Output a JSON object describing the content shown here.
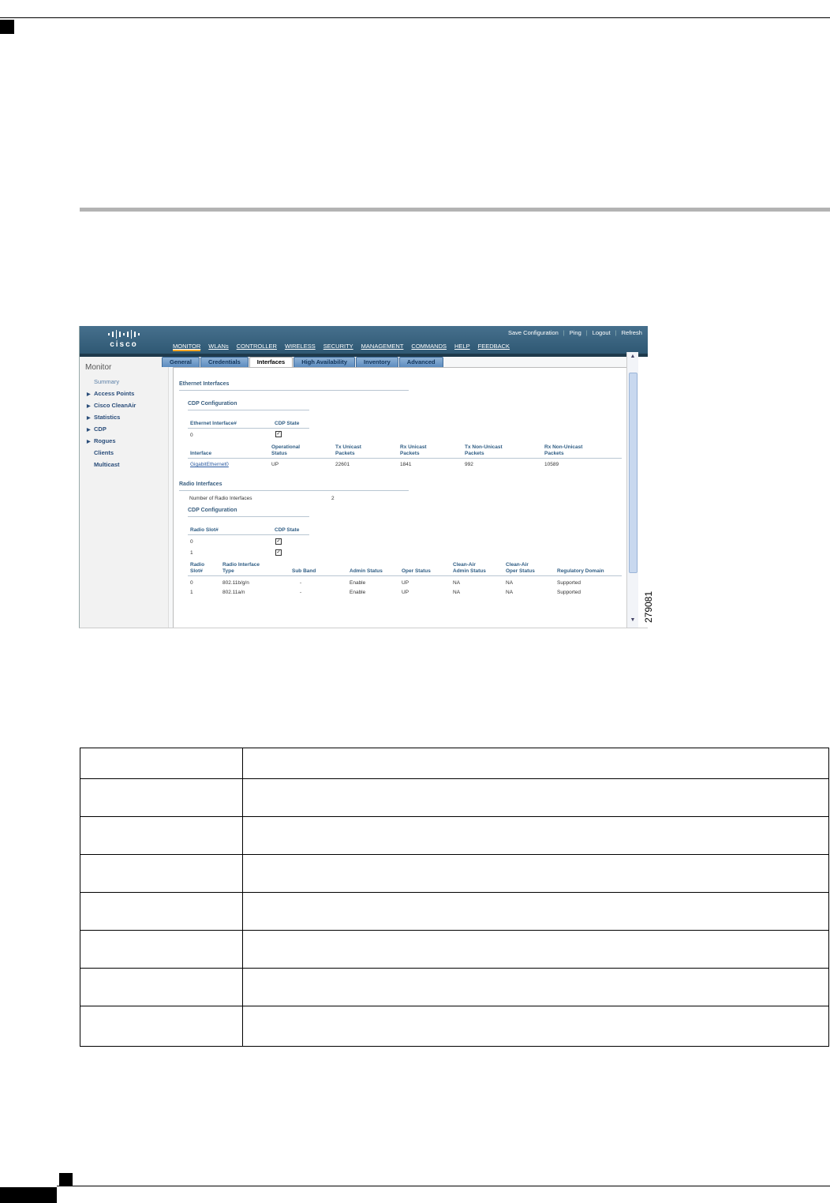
{
  "figure_id": "279081",
  "wlc": {
    "utility_links": [
      "Save Configuration",
      "Ping",
      "Logout",
      "Refresh"
    ],
    "nav": [
      "MONITOR",
      "WLANs",
      "CONTROLLER",
      "WIRELESS",
      "SECURITY",
      "MANAGEMENT",
      "COMMANDS",
      "HELP",
      "FEEDBACK"
    ],
    "logo_text": "cisco",
    "sidebar": {
      "title": "Monitor",
      "items": [
        {
          "label": "Summary",
          "arrow": false
        },
        {
          "label": "Access Points",
          "arrow": true
        },
        {
          "label": "Cisco CleanAir",
          "arrow": true
        },
        {
          "label": "Statistics",
          "arrow": true
        },
        {
          "label": "CDP",
          "arrow": true
        },
        {
          "label": "Rogues",
          "arrow": true
        },
        {
          "label": "Clients",
          "arrow": false
        },
        {
          "label": "Multicast",
          "arrow": false
        }
      ]
    },
    "tabs": [
      "General",
      "Credentials",
      "Interfaces",
      "High Availability",
      "Inventory",
      "Advanced"
    ],
    "active_tab": "Interfaces",
    "ethernet": {
      "section_title": "Ethernet Interfaces",
      "cdp_title": "CDP Configuration",
      "cdp_headers": [
        "Ethernet Interface#",
        "CDP State"
      ],
      "cdp_row": {
        "interface": "0",
        "checked": true
      },
      "iface_headers": [
        "Interface",
        "Operational\nStatus",
        "Tx Unicast\nPackets",
        "Rx Unicast\nPackets",
        "Tx Non-Unicast\nPackets",
        "Rx Non-Unicast\nPackets"
      ],
      "iface_row": [
        "GigabitEthernet0",
        "UP",
        "22601",
        "1841",
        "992",
        "10589"
      ]
    },
    "radio": {
      "section_title": "Radio Interfaces",
      "count_label": "Number of Radio Interfaces",
      "count_value": "2",
      "cdp_title": "CDP Configuration",
      "cdp_headers": [
        "Radio Slot#",
        "CDP State"
      ],
      "cdp_rows": [
        {
          "slot": "0",
          "checked": true
        },
        {
          "slot": "1",
          "checked": true
        }
      ],
      "headers": [
        "Radio\nSlot#",
        "Radio Interface\nType",
        "Sub Band",
        "Admin Status",
        "Oper Status",
        "Clean-Air\nAdmin Status",
        "Clean-Air\nOper Status",
        "Regulatory Domain"
      ],
      "rows": [
        [
          "0",
          "802.11b/g/n",
          "-",
          "Enable",
          "UP",
          "NA",
          "NA",
          "Supported"
        ],
        [
          "1",
          "802.11a/n",
          "-",
          "Enable",
          "UP",
          "NA",
          "NA",
          "Supported"
        ]
      ]
    }
  },
  "param_table": {
    "rows": 8
  }
}
